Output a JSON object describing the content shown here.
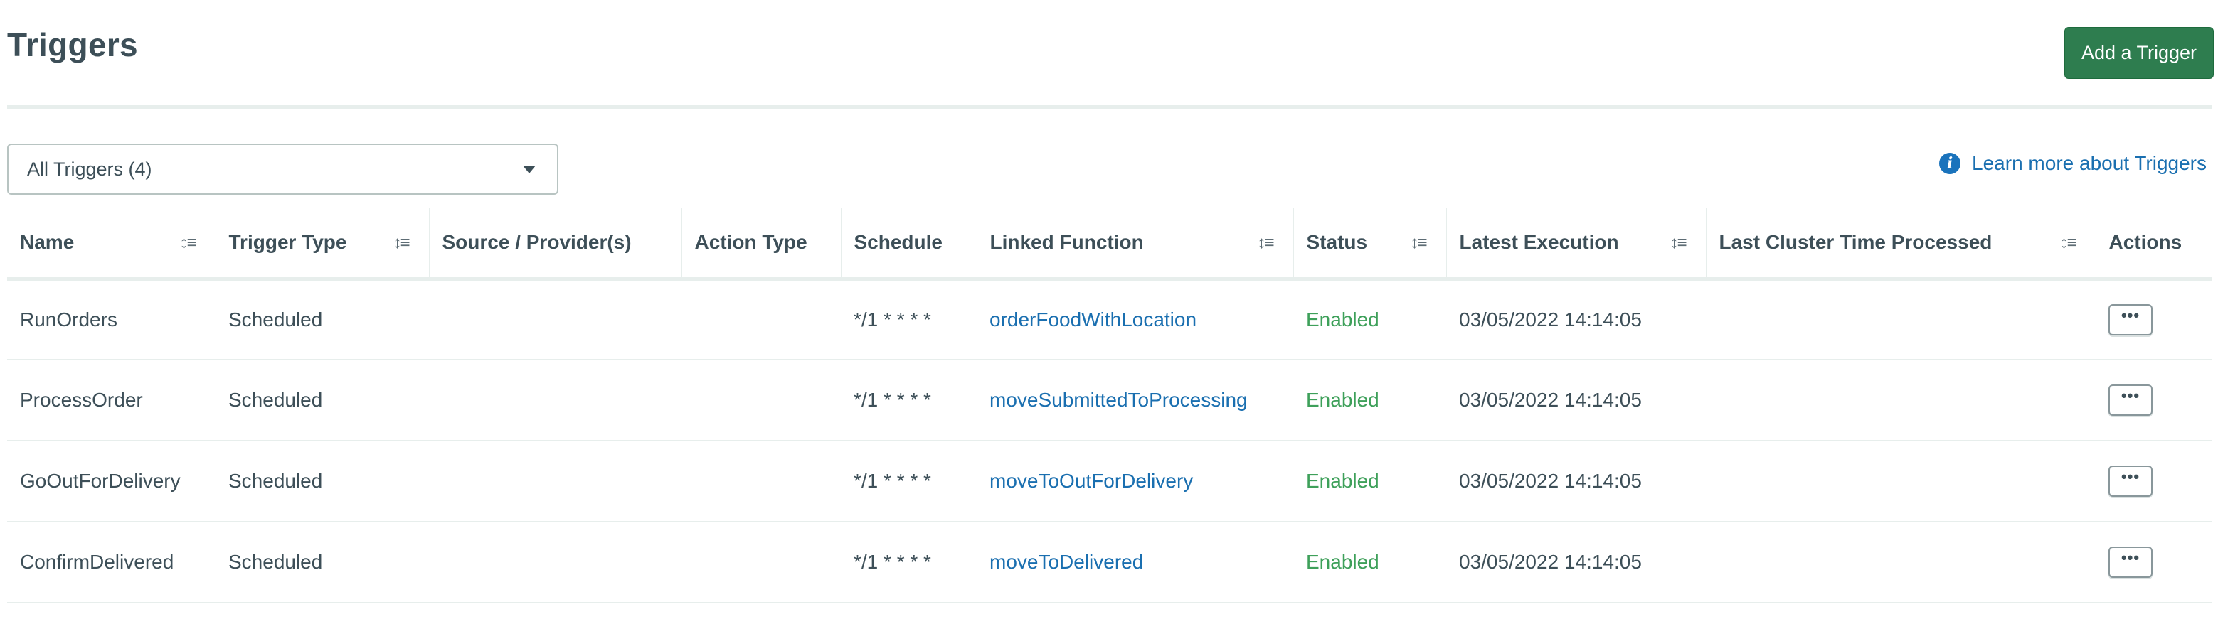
{
  "header": {
    "title": "Triggers",
    "add_button_label": "Add a Trigger",
    "brand_color": "#2e7d4f"
  },
  "filter": {
    "selected": "All Triggers (4)",
    "caret_icon": "caret-down-icon"
  },
  "learn_more": {
    "icon": "info-icon",
    "label": "Learn more about Triggers"
  },
  "table": {
    "columns": [
      {
        "label": "Name",
        "sortable": true
      },
      {
        "label": "Trigger Type",
        "sortable": true
      },
      {
        "label": "Source / Provider(s)",
        "sortable": false
      },
      {
        "label": "Action Type",
        "sortable": false
      },
      {
        "label": "Schedule",
        "sortable": false
      },
      {
        "label": "Linked Function",
        "sortable": true
      },
      {
        "label": "Status",
        "sortable": true
      },
      {
        "label": "Latest Execution",
        "sortable": true
      },
      {
        "label": "Last Cluster Time Processed",
        "sortable": true
      },
      {
        "label": "Actions",
        "sortable": false
      }
    ],
    "sort_icon": "sort-icon",
    "actions_icon": "ellipsis-icon",
    "rows": [
      {
        "name": "RunOrders",
        "type": "Scheduled",
        "source": "",
        "action_type": "",
        "schedule": "*/1 * * * *",
        "function": "orderFoodWithLocation",
        "status": "Enabled",
        "latest": "03/05/2022 14:14:05",
        "cluster_time": "",
        "actions_label": "•••"
      },
      {
        "name": "ProcessOrder",
        "type": "Scheduled",
        "source": "",
        "action_type": "",
        "schedule": "*/1 * * * *",
        "function": "moveSubmittedToProcessing",
        "status": "Enabled",
        "latest": "03/05/2022 14:14:05",
        "cluster_time": "",
        "actions_label": "•••"
      },
      {
        "name": "GoOutForDelivery",
        "type": "Scheduled",
        "source": "",
        "action_type": "",
        "schedule": "*/1 * * * *",
        "function": "moveToOutForDelivery",
        "status": "Enabled",
        "latest": "03/05/2022 14:14:05",
        "cluster_time": "",
        "actions_label": "•••"
      },
      {
        "name": "ConfirmDelivered",
        "type": "Scheduled",
        "source": "",
        "action_type": "",
        "schedule": "*/1 * * * *",
        "function": "moveToDelivered",
        "status": "Enabled",
        "latest": "03/05/2022 14:14:05",
        "cluster_time": "",
        "actions_label": "•••"
      }
    ]
  },
  "colors": {
    "link": "#1a6fb0",
    "status_enabled": "#3ea05a",
    "text": "#3d4f58",
    "divider": "#e7eeec"
  }
}
